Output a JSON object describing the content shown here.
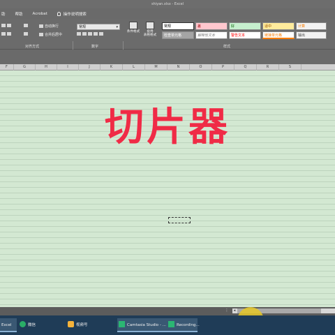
{
  "window": {
    "title": "shiyan.xlsx  -  Excel"
  },
  "menu": {
    "items": [
      "助",
      "帮助",
      "Acrobat"
    ],
    "tell_me": "操作说明搜索"
  },
  "ribbon": {
    "wrap_text": "自动换行",
    "merge_center": "合并后居中",
    "number_format": "常规",
    "conditional_format": "条件格式",
    "table_format_line1": "套用",
    "table_format_line2": "表格格式",
    "groups": {
      "alignment": "对齐方式",
      "number": "数字",
      "styles": "样式"
    },
    "styles": [
      {
        "label": "常规",
        "bg": "#ffffff",
        "fg": "#000000"
      },
      {
        "label": "差",
        "bg": "#ffc7ce",
        "fg": "#9c0006"
      },
      {
        "label": "好",
        "bg": "#c6efce",
        "fg": "#006100"
      },
      {
        "label": "适中",
        "bg": "#ffeb9c",
        "fg": "#9c5700"
      },
      {
        "label": "计算",
        "bg": "#f2f2f2",
        "fg": "#fa7d00"
      },
      {
        "label": "检查单元格",
        "bg": "#a5a5a5",
        "fg": "#ffffff"
      },
      {
        "label": "解释性文本",
        "bg": "#ffffff",
        "fg": "#7f7f7f"
      },
      {
        "label": "警告文本",
        "bg": "#ffffff",
        "fg": "#ff0000"
      },
      {
        "label": "链接单元格",
        "bg": "#ffffff",
        "fg": "#fa7d00"
      },
      {
        "label": "输出",
        "bg": "#f2f2f2",
        "fg": "#3f3f3f"
      }
    ]
  },
  "columns": [
    "F",
    "G",
    "H",
    "I",
    "J",
    "K",
    "L",
    "M",
    "N",
    "O",
    "P",
    "Q",
    "R",
    "S"
  ],
  "sheet": {
    "big_text": "切片器"
  },
  "taskbar": {
    "items": [
      {
        "label": "Excel",
        "icon": "excel-icon",
        "active": true
      },
      {
        "label": "微信",
        "icon": "wechat-icon",
        "active": false
      },
      {
        "label": "视频号",
        "icon": "video-channel-icon",
        "active": false
      },
      {
        "label": "Camtasia Studio - ...",
        "icon": "camtasia-icon",
        "active": true
      },
      {
        "label": "Recording...",
        "icon": "recording-icon",
        "active": true
      }
    ]
  },
  "colors": {
    "accent_red": "#f02b46",
    "sheet_bg": "#d3e8d2",
    "taskbar_bg": "#1f3c57",
    "cursor_highlight": "#e6c828"
  }
}
